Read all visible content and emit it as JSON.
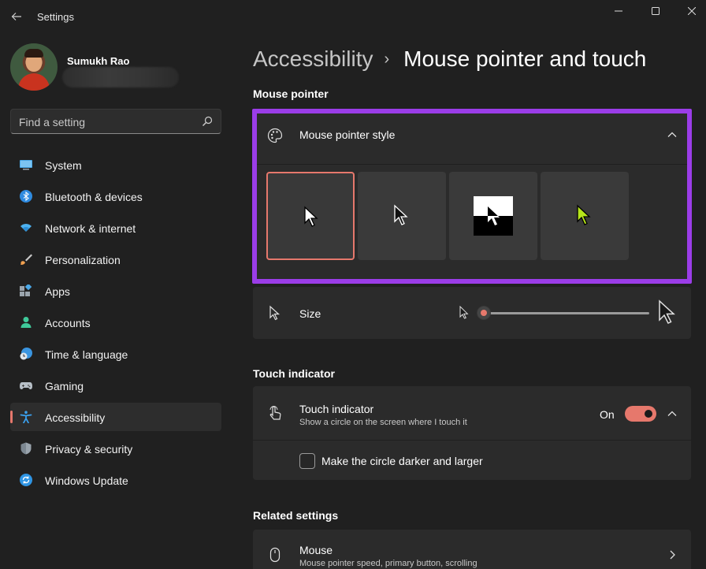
{
  "window": {
    "title": "Settings",
    "back_icon": "back-arrow-icon",
    "controls": [
      "minimize-icon",
      "maximize-icon",
      "close-icon"
    ]
  },
  "profile": {
    "name": "Sumukh Rao"
  },
  "search": {
    "placeholder": "Find a setting"
  },
  "sidebar": {
    "items": [
      {
        "label": "System",
        "icon": "system-icon",
        "active": false
      },
      {
        "label": "Bluetooth & devices",
        "icon": "bluetooth-icon",
        "active": false
      },
      {
        "label": "Network & internet",
        "icon": "network-icon",
        "active": false
      },
      {
        "label": "Personalization",
        "icon": "brush-icon",
        "active": false
      },
      {
        "label": "Apps",
        "icon": "apps-icon",
        "active": false
      },
      {
        "label": "Accounts",
        "icon": "accounts-icon",
        "active": false
      },
      {
        "label": "Time & language",
        "icon": "globe-clock-icon",
        "active": false
      },
      {
        "label": "Gaming",
        "icon": "gamepad-icon",
        "active": false
      },
      {
        "label": "Accessibility",
        "icon": "accessibility-icon",
        "active": true
      },
      {
        "label": "Privacy & security",
        "icon": "shield-icon",
        "active": false
      },
      {
        "label": "Windows Update",
        "icon": "windows-update-icon",
        "active": false
      }
    ]
  },
  "breadcrumb": {
    "parent": "Accessibility",
    "separator": "›",
    "current": "Mouse pointer and touch"
  },
  "mouse_pointer": {
    "section_title": "Mouse pointer",
    "style_card": {
      "label": "Mouse pointer style",
      "icon": "palette-icon",
      "expanded": true,
      "options": [
        {
          "name": "white",
          "selected": true
        },
        {
          "name": "black",
          "selected": false
        },
        {
          "name": "inverted",
          "selected": false
        },
        {
          "name": "custom",
          "selected": false,
          "color": "#b6e51a"
        }
      ]
    },
    "size_card": {
      "label": "Size",
      "icon": "pointer-size-icon",
      "slider_value": 0.0
    }
  },
  "touch_indicator": {
    "section_title": "Touch indicator",
    "label": "Touch indicator",
    "description": "Show a circle on the screen where I touch it",
    "icon": "touch-icon",
    "state": "On",
    "toggle_on": true,
    "checkbox_label": "Make the circle darker and larger",
    "checkbox_checked": false
  },
  "related": {
    "section_title": "Related settings",
    "mouse": {
      "label": "Mouse",
      "description": "Mouse pointer speed, primary button, scrolling",
      "icon": "mouse-icon"
    }
  },
  "colors": {
    "accent": "#e6786c",
    "highlight_border": "#9b3de8",
    "background": "#202020",
    "card": "#2b2b2b"
  }
}
